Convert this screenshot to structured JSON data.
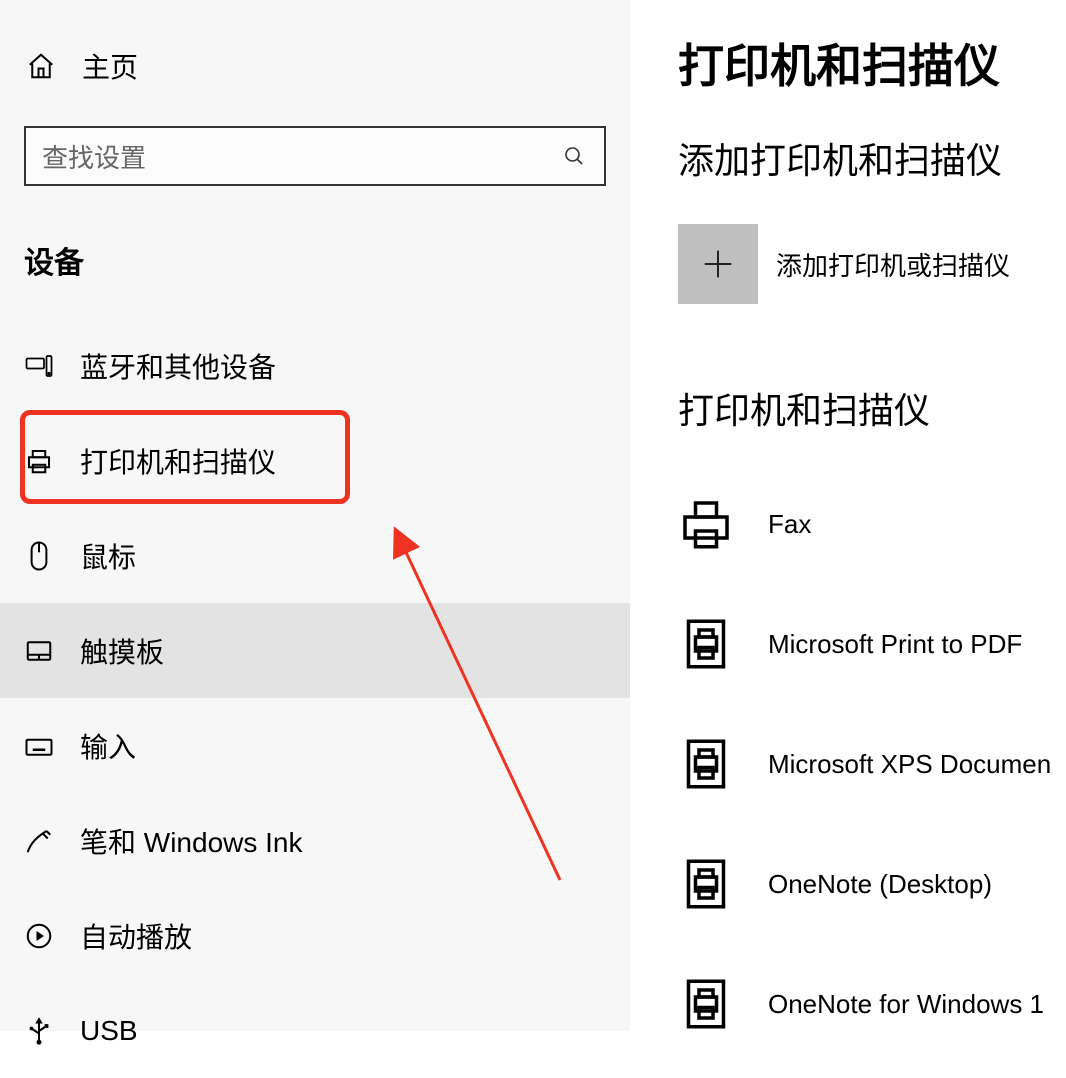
{
  "sidebar": {
    "home_label": "主页",
    "search_placeholder": "查找设置",
    "section_title": "设备",
    "items": [
      {
        "label": "蓝牙和其他设备"
      },
      {
        "label": "打印机和扫描仪"
      },
      {
        "label": "鼠标"
      },
      {
        "label": "触摸板"
      },
      {
        "label": "输入"
      },
      {
        "label": "笔和 Windows Ink"
      },
      {
        "label": "自动播放"
      },
      {
        "label": "USB"
      }
    ]
  },
  "main": {
    "page_title": "打印机和扫描仪",
    "add_heading": "添加打印机和扫描仪",
    "add_label": "添加打印机或扫描仪",
    "list_heading": "打印机和扫描仪",
    "printers": [
      {
        "label": "Fax"
      },
      {
        "label": "Microsoft Print to PDF"
      },
      {
        "label": "Microsoft XPS Documen"
      },
      {
        "label": "OneNote (Desktop)"
      },
      {
        "label": "OneNote for Windows 1"
      }
    ]
  }
}
